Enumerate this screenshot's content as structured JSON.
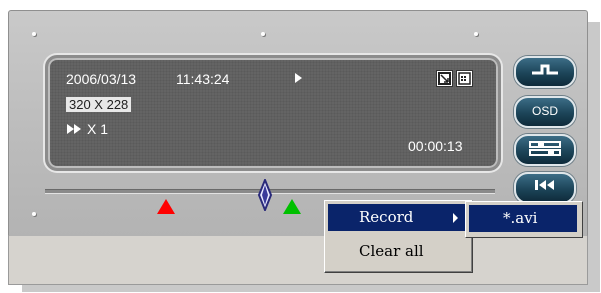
{
  "display": {
    "date": "2006/03/13",
    "time": "11:43:24",
    "resolution": "320 X 228",
    "speed": "X 1",
    "elapsed": "00:00:13"
  },
  "side_buttons": {
    "osd_label": "OSD"
  },
  "icons": {
    "play": "play-icon",
    "fast_forward": "fast-forward-icon",
    "fit_window": "fit-window-icon",
    "grid_view": "grid-view-icon",
    "step": "step-icon",
    "settings": "settings-icon",
    "rewind_to_start": "skip-to-start-icon"
  },
  "context_menu": {
    "items": [
      {
        "label": "Record",
        "has_submenu": true,
        "highlighted": true
      },
      {
        "label": "Clear all",
        "has_submenu": false,
        "highlighted": false
      }
    ],
    "submenu": [
      {
        "label": "*.avi",
        "highlighted": true
      }
    ]
  },
  "colors": {
    "lcd_background": "#646464",
    "button_blue": "#1c4458",
    "marker_start": "#ff0000",
    "marker_end": "#00c000",
    "menu_highlight": "#0a246a"
  }
}
